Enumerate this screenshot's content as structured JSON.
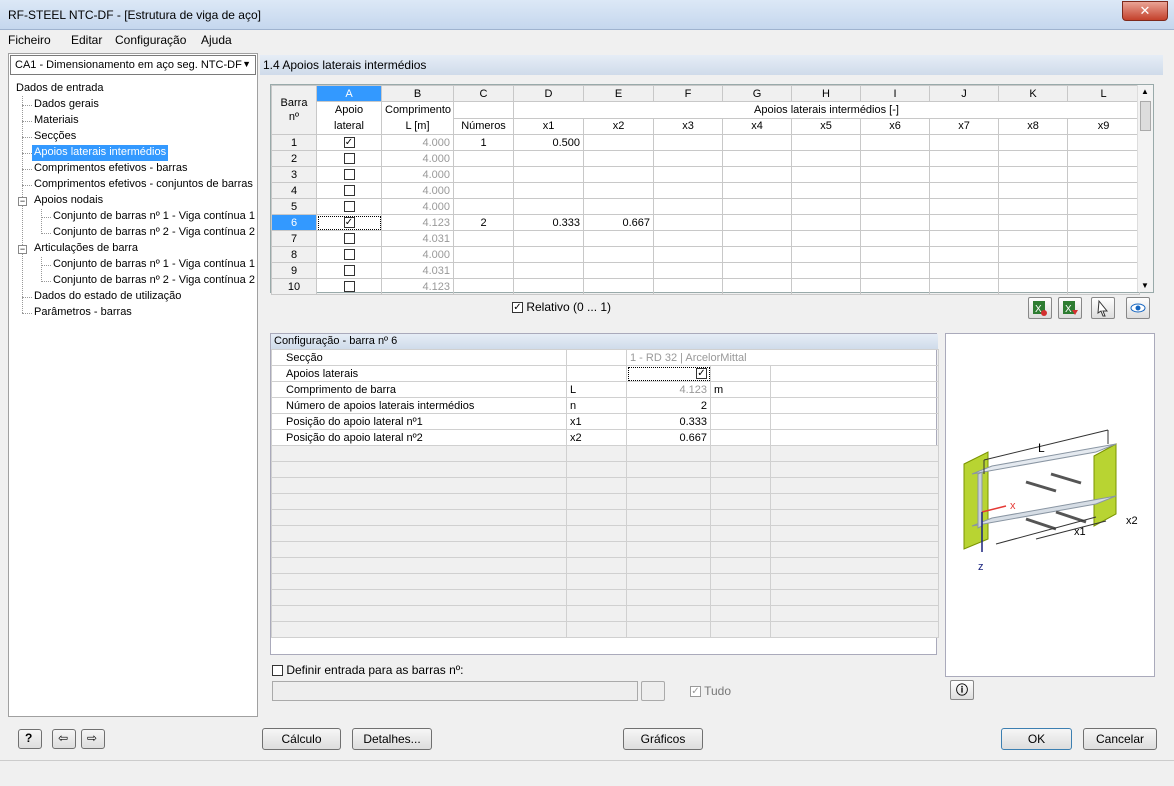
{
  "window": {
    "title": "RF-STEEL NTC-DF - [Estrutura de viga de aço]",
    "close_glyph": "✕"
  },
  "menu": [
    "Ficheiro",
    "Editar",
    "Configuração",
    "Ajuda"
  ],
  "case_select": "CA1 - Dimensionamento em aço seg. NTC-DF",
  "tree": {
    "root": "Dados de entrada",
    "items": [
      "Dados gerais",
      "Materiais",
      "Secções",
      "Apoios laterais intermédios",
      "Comprimentos efetivos - barras",
      "Comprimentos efetivos - conjuntos de barras",
      "Apoios nodais",
      "Conjunto de barras nº 1 - Viga contínua 1",
      "Conjunto de barras nº 2 - Viga contínua 2",
      "Articulações de barra",
      "Conjunto de barras nº 1 - Viga contínua 1",
      "Conjunto de barras nº 2 - Viga contínua 2",
      "Dados do estado de utilização",
      "Parâmetros - barras"
    ]
  },
  "section_title": "1.4 Apoios laterais intermédios",
  "grid": {
    "col_letters": [
      "A",
      "B",
      "C",
      "D",
      "E",
      "F",
      "G",
      "H",
      "I",
      "J",
      "K",
      "L"
    ],
    "hdr_barra": "Barra nº",
    "hdr_apoio": "Apoio lateral",
    "hdr_comp": "Comprimento L [m]",
    "hdr_group": "Apoios laterais intermédios [-]",
    "hdr_numeros": "Números",
    "x_labels": [
      "x1",
      "x2",
      "x3",
      "x4",
      "x5",
      "x6",
      "x7",
      "x8",
      "x9"
    ],
    "rows": [
      {
        "n": "1",
        "checked": true,
        "L": "4.000",
        "num": "1",
        "x": [
          "0.500",
          ""
        ]
      },
      {
        "n": "2",
        "checked": false,
        "L": "4.000",
        "num": "",
        "x": [
          "",
          ""
        ]
      },
      {
        "n": "3",
        "checked": false,
        "L": "4.000",
        "num": "",
        "x": [
          "",
          ""
        ]
      },
      {
        "n": "4",
        "checked": false,
        "L": "4.000",
        "num": "",
        "x": [
          "",
          ""
        ]
      },
      {
        "n": "5",
        "checked": false,
        "L": "4.000",
        "num": "",
        "x": [
          "",
          ""
        ]
      },
      {
        "n": "6",
        "checked": true,
        "L": "4.123",
        "num": "2",
        "x": [
          "0.333",
          "0.667"
        ],
        "selected": true
      },
      {
        "n": "7",
        "checked": false,
        "L": "4.031",
        "num": "",
        "x": [
          "",
          ""
        ]
      },
      {
        "n": "8",
        "checked": false,
        "L": "4.000",
        "num": "",
        "x": [
          "",
          ""
        ]
      },
      {
        "n": "9",
        "checked": false,
        "L": "4.031",
        "num": "",
        "x": [
          "",
          ""
        ]
      },
      {
        "n": "10",
        "checked": false,
        "L": "4.123",
        "num": "",
        "x": [
          "",
          ""
        ]
      }
    ]
  },
  "relativo_label": "Relativo (0 ... 1)",
  "check_glyph": "✓",
  "config": {
    "title": "Configuração - barra nº 6",
    "rows": [
      {
        "label": "Secção",
        "sym": "",
        "value": "1 - RD 32 | ArcelorMittal",
        "unit": ""
      },
      {
        "label": "Apoios laterais",
        "sym": "",
        "value": "",
        "unit": ""
      },
      {
        "label": "Comprimento de barra",
        "sym": "L",
        "value": "4.123",
        "unit": "m"
      },
      {
        "label": "Número de apoios laterais intermédios",
        "sym": "n",
        "value": "2",
        "unit": ""
      },
      {
        "label": "Posição do apoio lateral nº1",
        "sym": "x1",
        "value": "0.333",
        "unit": ""
      },
      {
        "label": "Posição do apoio lateral nº2",
        "sym": "x2",
        "value": "0.667",
        "unit": ""
      }
    ]
  },
  "illustration": {
    "L": "L",
    "x": "x",
    "z": "z",
    "x1": "x1",
    "x2": "x2"
  },
  "define_label": "Definir entrada para as barras nº:",
  "tudo_label": "Tudo",
  "buttons": {
    "calculo": "Cálculo",
    "detalhes": "Detalhes...",
    "graficos": "Gráficos",
    "ok": "OK",
    "cancelar": "Cancelar"
  },
  "colors": {
    "selection": "#3399ff",
    "header": "#cfdbea",
    "support": "#b8d432"
  }
}
